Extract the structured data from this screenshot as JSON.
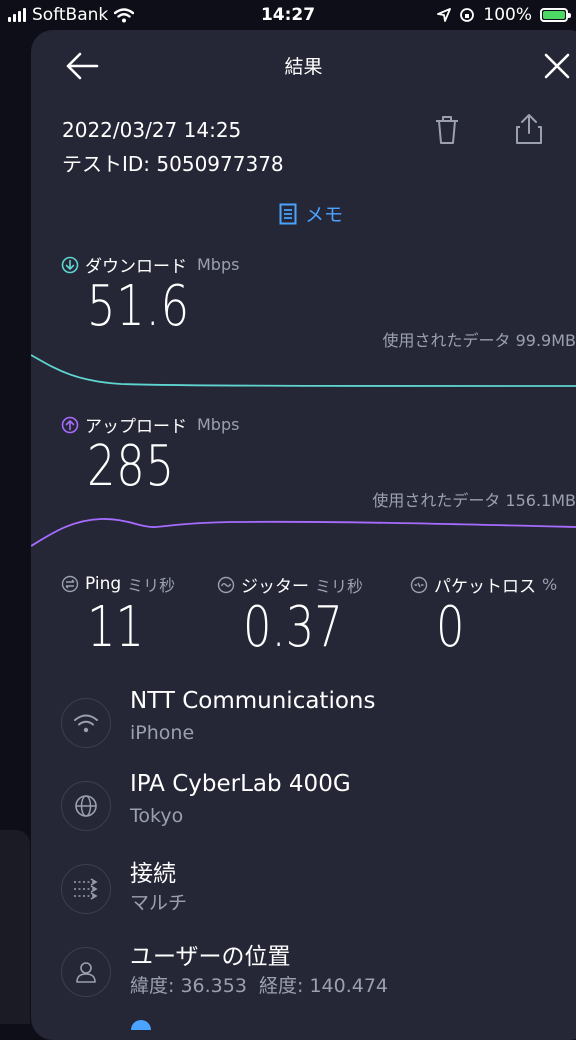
{
  "status_bar": {
    "carrier": "SoftBank",
    "time": "14:27",
    "battery": "100%"
  },
  "header": {
    "title": "結果"
  },
  "meta": {
    "datetime": "2022/03/27 14:25",
    "test_id": "テストID: 5050977378"
  },
  "memo": {
    "label": "メモ"
  },
  "download": {
    "label": "ダウンロード",
    "unit": "Mbps",
    "value": "51.6",
    "data_used": "使用されたデータ 99.9MB",
    "color": "#5fd4d0"
  },
  "upload": {
    "label": "アップロード",
    "unit": "Mbps",
    "value": "285",
    "data_used": "使用されたデータ 156.1MB",
    "color": "#a66bff"
  },
  "ping": {
    "label": "Ping",
    "unit": "ミリ秒",
    "value": "11"
  },
  "jitter": {
    "label": "ジッター",
    "unit": "ミリ秒",
    "value": "0.37"
  },
  "packet_loss": {
    "label": "パケットロス",
    "unit": "%",
    "value": "0"
  },
  "details": [
    {
      "title": "NTT Communications",
      "subtitle": "iPhone",
      "icon": "wifi-icon"
    },
    {
      "title": "IPA CyberLab 400G",
      "subtitle": "Tokyo",
      "icon": "globe-icon"
    },
    {
      "title": "接続",
      "subtitle": "マルチ",
      "icon": "connections-icon"
    },
    {
      "title": "ユーザーの位置",
      "subtitle": "緯度: 36.353  経度: 140.474",
      "icon": "user-icon"
    }
  ]
}
